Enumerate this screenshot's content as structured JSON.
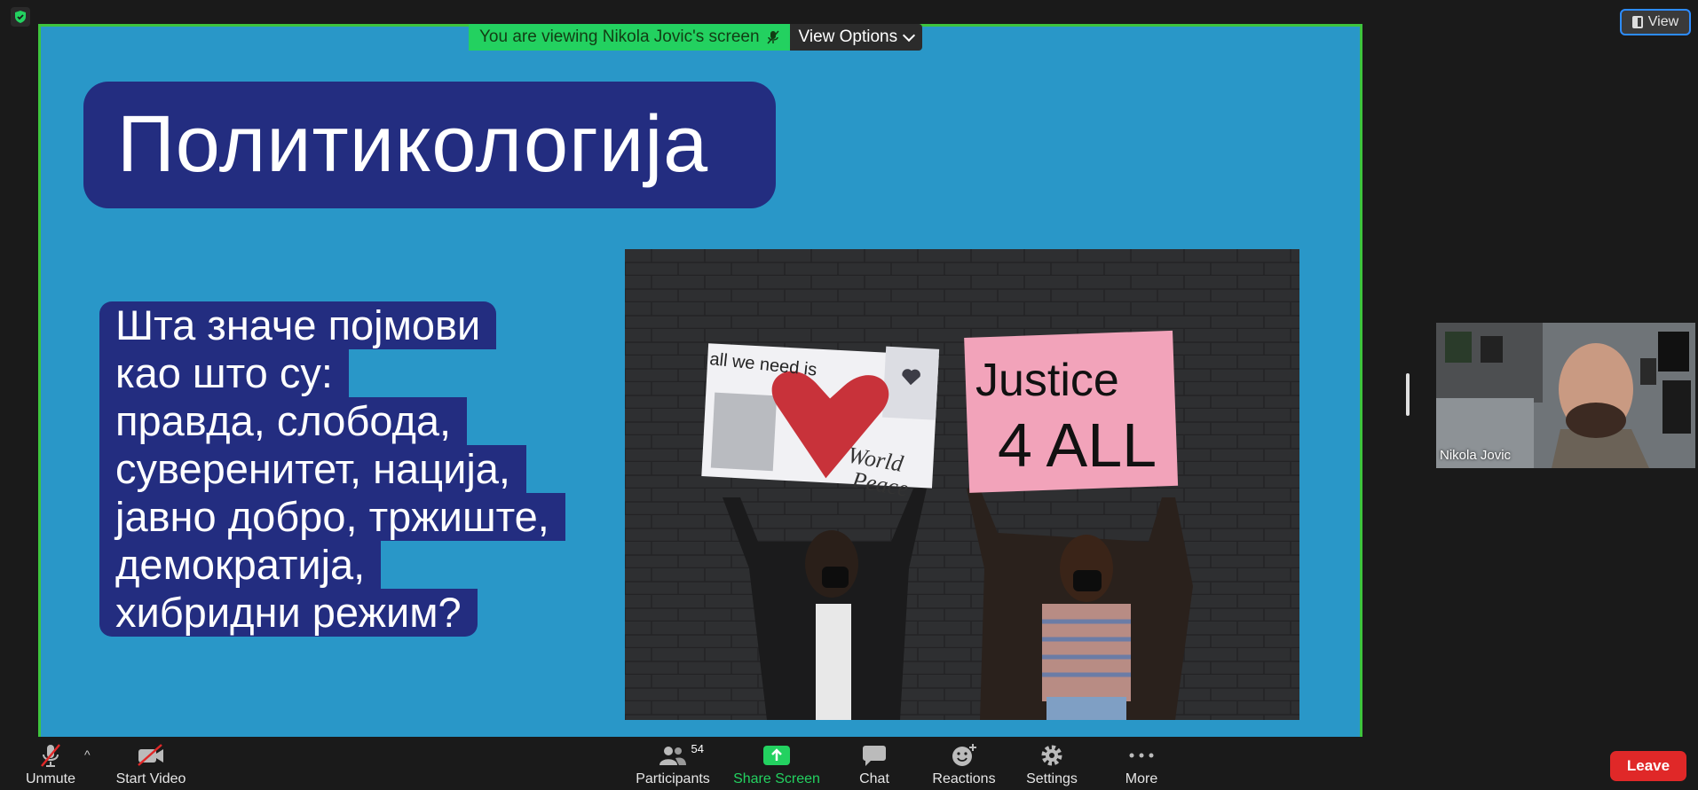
{
  "banner": {
    "viewing_text": "You are viewing Nikola Jovic's screen",
    "options_label": "View Options"
  },
  "top_right": {
    "view_label": "View"
  },
  "slide": {
    "title": "Политикологија",
    "question_lines": [
      "Шта значе појмови",
      "као што су:",
      "правда, слобода,",
      "суверенитет, нација,",
      "јавно добро, тржиште,",
      "демократија,",
      "хибридни режим?"
    ],
    "photo_signs": {
      "left_sign_line1": "all we need is",
      "left_sign_line2": "World",
      "left_sign_line3": "Peace",
      "right_sign_line1": "Justice",
      "right_sign_line2": "4 ALL"
    }
  },
  "participant": {
    "name": "Nikola Jovic"
  },
  "toolbar": {
    "unmute": "Unmute",
    "start_video": "Start Video",
    "participants": "Participants",
    "participants_count": "54",
    "share_screen": "Share Screen",
    "chat": "Chat",
    "reactions": "Reactions",
    "settings": "Settings",
    "more": "More",
    "leave": "Leave"
  },
  "colors": {
    "share_border": "#3ec43e",
    "slide_bg": "#2997c8",
    "title_box": "#232d80",
    "leave": "#e02828",
    "green_accent": "#23d160"
  }
}
